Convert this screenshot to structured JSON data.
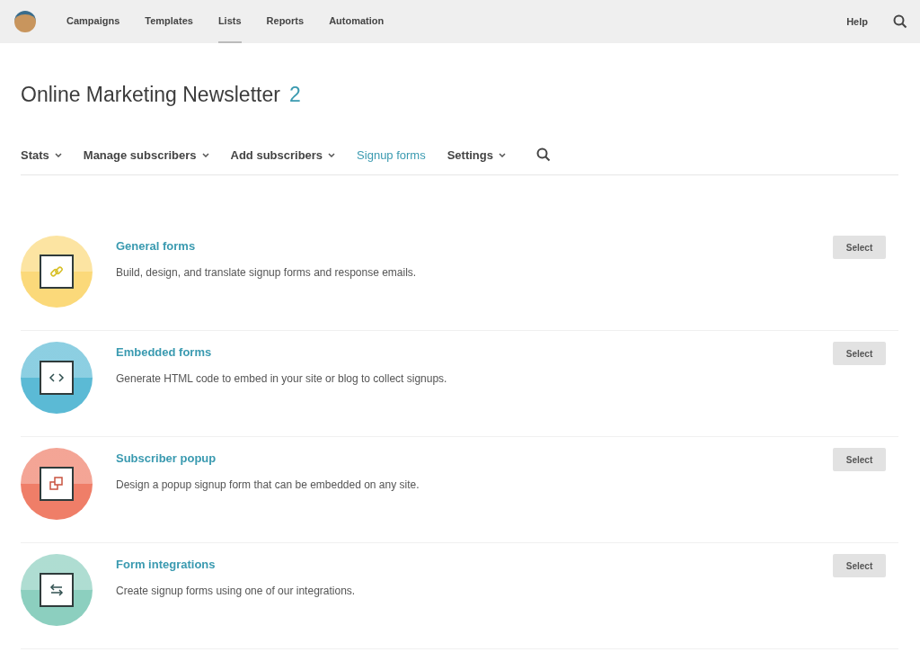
{
  "top_nav": {
    "items": [
      {
        "label": "Campaigns",
        "selected": false
      },
      {
        "label": "Templates",
        "selected": false
      },
      {
        "label": "Lists",
        "selected": true
      },
      {
        "label": "Reports",
        "selected": false
      },
      {
        "label": "Automation",
        "selected": false
      }
    ],
    "help": "Help"
  },
  "page": {
    "title": "Online Marketing Newsletter",
    "count": "2"
  },
  "sub_nav": [
    {
      "label": "Stats",
      "selected": false,
      "dropdown": true
    },
    {
      "label": "Manage subscribers",
      "selected": false,
      "dropdown": true
    },
    {
      "label": "Add subscribers",
      "selected": false,
      "dropdown": true
    },
    {
      "label": "Signup forms",
      "selected": true,
      "dropdown": false
    },
    {
      "label": "Settings",
      "selected": false,
      "dropdown": true
    }
  ],
  "form_types": [
    {
      "kind": "link",
      "color": "#fbd97a",
      "title": "General forms",
      "description": "Build, design, and translate signup forms and response emails.",
      "button": "Select"
    },
    {
      "kind": "code",
      "color": "#5bbad5",
      "title": "Embedded forms",
      "description": "Generate HTML code to embed in your site or blog to collect signups.",
      "button": "Select"
    },
    {
      "kind": "popup",
      "color": "#ef7e68",
      "title": "Subscriber popup",
      "description": "Design a popup signup form that can be embedded on any site.",
      "button": "Select"
    },
    {
      "kind": "arrows",
      "color": "#8ccfbf",
      "title": "Form integrations",
      "description": "Create signup forms using one of our integrations.",
      "button": "Select"
    }
  ]
}
